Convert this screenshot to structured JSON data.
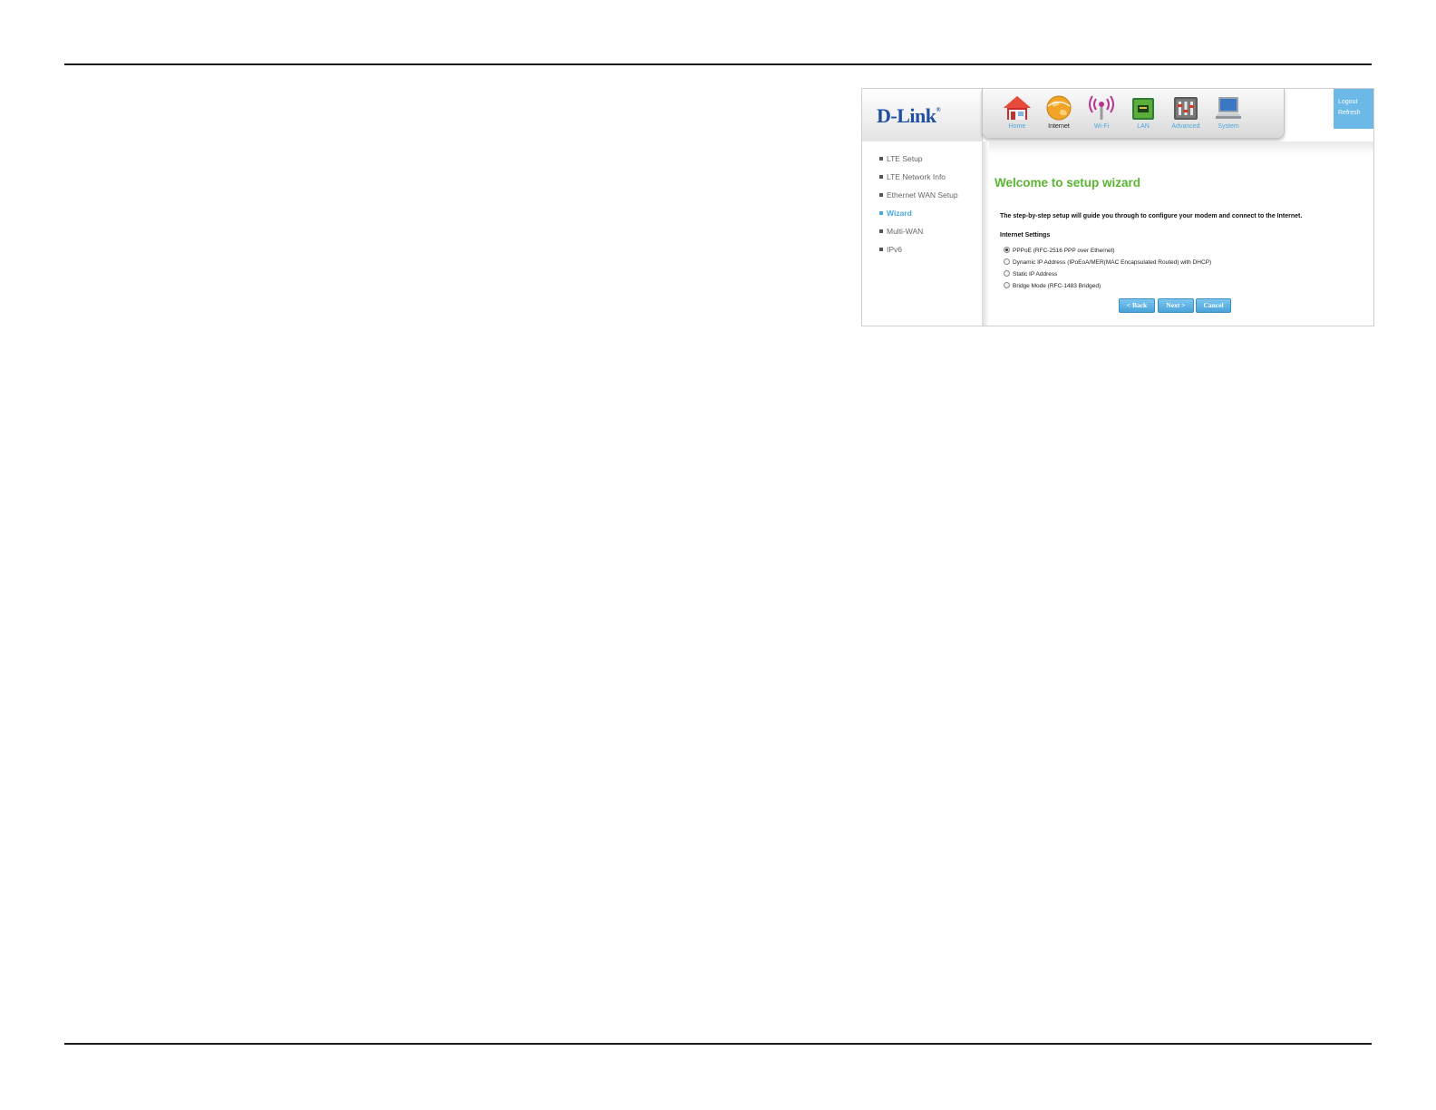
{
  "brand": {
    "name": "D-Link",
    "reg": "®"
  },
  "topnav": [
    {
      "label": "Home",
      "icon": "home-icon",
      "active": false
    },
    {
      "label": "Internet",
      "icon": "internet-globe-icon",
      "active": true
    },
    {
      "label": "Wi-Fi",
      "icon": "wifi-icon",
      "active": false
    },
    {
      "label": "LAN",
      "icon": "lan-port-icon",
      "active": false
    },
    {
      "label": "Advanced",
      "icon": "advanced-tools-icon",
      "active": false
    },
    {
      "label": "System",
      "icon": "system-laptop-icon",
      "active": false
    }
  ],
  "session": {
    "logout": "Logout",
    "refresh": "Refresh"
  },
  "sidebar": {
    "items": [
      {
        "label": "LTE Setup",
        "active": false
      },
      {
        "label": "LTE Network Info",
        "active": false
      },
      {
        "label": "Ethernet WAN Setup",
        "active": false
      },
      {
        "label": "Wizard",
        "active": true
      },
      {
        "label": "Multi-WAN",
        "active": false
      },
      {
        "label": "IPv6",
        "active": false
      }
    ]
  },
  "main": {
    "title": "Welcome to setup wizard",
    "intro": "The step-by-step setup will guide you through to configure your modem and connect to the Internet.",
    "section": "Internet Settings",
    "options": [
      {
        "label": "PPPoE (RFC-2516 PPP over Ethernet)",
        "selected": true
      },
      {
        "label": "Dynamic IP Address (IPoEoA/MER(MAC Encapsulated Routed) with DHCP)",
        "selected": false
      },
      {
        "label": "Static IP Address",
        "selected": false
      },
      {
        "label": "Bridge Mode (RFC-1483 Bridged)",
        "selected": false
      }
    ],
    "buttons": {
      "back": "< Back",
      "next": "Next >",
      "cancel": "Cancel"
    }
  },
  "colors": {
    "accent_blue": "#4aa8df",
    "title_green": "#5ab532",
    "brand_blue": "#1f4fa3"
  }
}
